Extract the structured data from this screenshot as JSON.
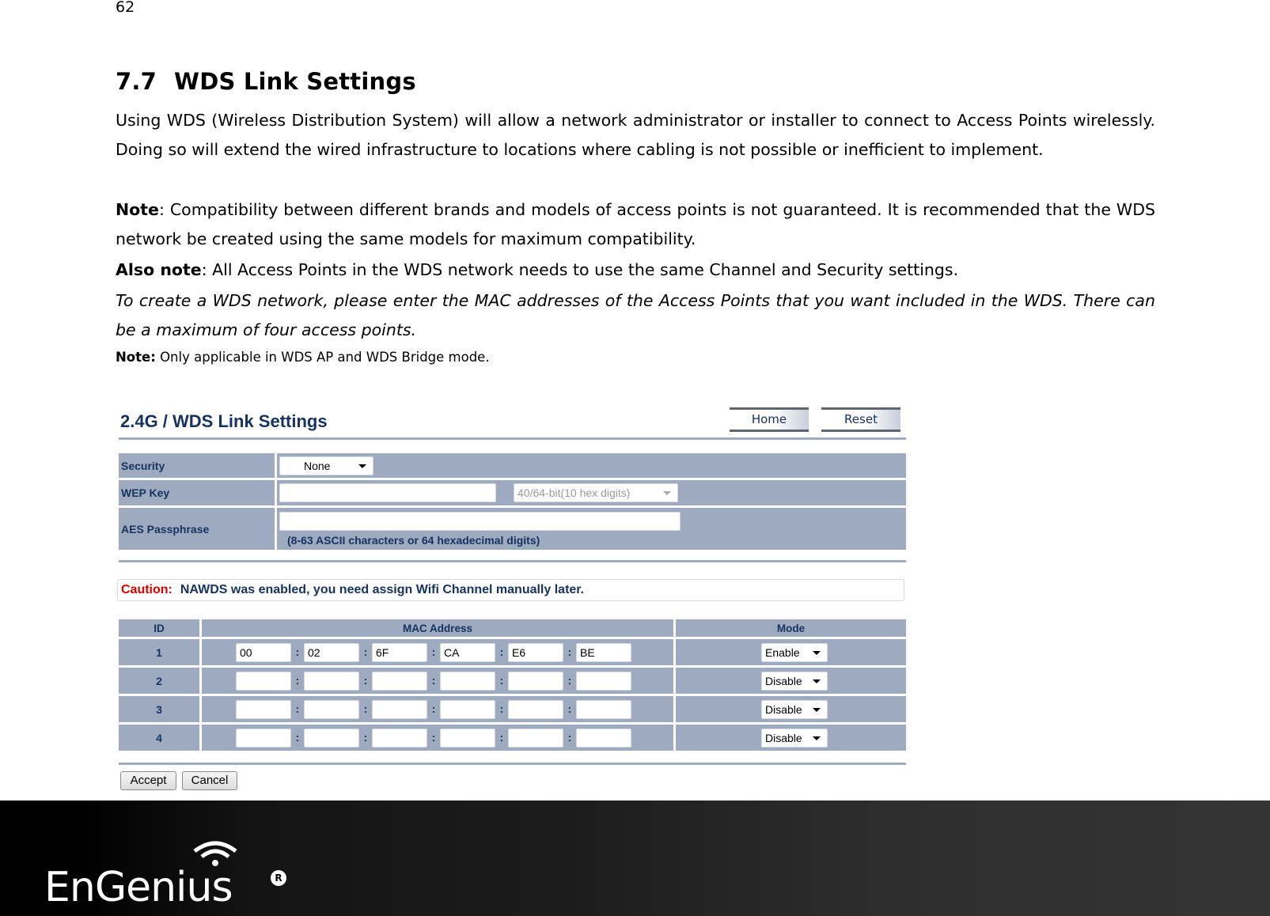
{
  "page_number": "62",
  "section": {
    "number": "7.7",
    "title": "WDS Link Settings"
  },
  "paragraphs": {
    "intro": "Using WDS (Wireless Distribution System) will allow a network administrator or installer to connect to Access Points wirelessly. Doing so will extend the wired infrastructure to locations where cabling is not possible or inefficient to implement.",
    "note_label": "Note",
    "note_text": ": Compatibility between different brands and models of access points is not guaranteed. It is recommended that the WDS network be created using the same models for maximum compatibility.",
    "also_note_label": "Also note",
    "also_note_text": ": All Access Points in the WDS network needs to use the same Channel and Security settings.",
    "instruction": "To create a WDS network, please enter the MAC addresses of the Access Points that you want included in the WDS. There can be a maximum of four access points.",
    "small_note_label": "Note:",
    "small_note_text": " Only applicable in WDS AP and WDS Bridge mode."
  },
  "ui": {
    "title": "2.4G / WDS Link Settings",
    "home_button": "Home",
    "reset_button": "Reset",
    "security": {
      "label": "Security",
      "value": "None"
    },
    "wep_key": {
      "label": "WEP Key",
      "value": "",
      "key_length": "40/64-bit(10 hex digits)"
    },
    "aes": {
      "label": "AES Passphrase",
      "value": "",
      "hint": "(8-63 ASCII characters or 64 hexadecimal digits)"
    },
    "caution_label": "Caution:",
    "caution_text": "NAWDS was enabled, you need assign Wifi Channel manually later.",
    "table_headers": {
      "id": "ID",
      "mac": "MAC Address",
      "mode": "Mode"
    },
    "rows": [
      {
        "id": "1",
        "mac": [
          "00",
          "02",
          "6F",
          "CA",
          "E6",
          "BE"
        ],
        "mode": "Enable"
      },
      {
        "id": "2",
        "mac": [
          "",
          "",
          "",
          "",
          "",
          ""
        ],
        "mode": "Disable"
      },
      {
        "id": "3",
        "mac": [
          "",
          "",
          "",
          "",
          "",
          ""
        ],
        "mode": "Disable"
      },
      {
        "id": "4",
        "mac": [
          "",
          "",
          "",
          "",
          "",
          ""
        ],
        "mode": "Disable"
      }
    ],
    "separator": ":",
    "accept_button": "Accept",
    "cancel_button": "Cancel"
  },
  "footer": {
    "brand": "EnGenius",
    "registered": "R"
  }
}
